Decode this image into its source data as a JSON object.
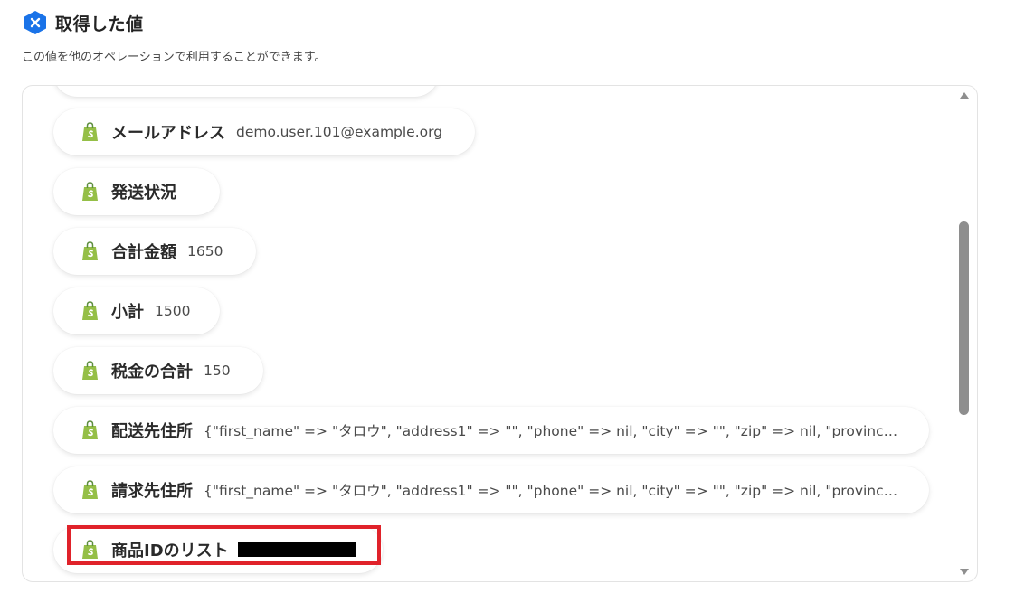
{
  "header": {
    "title": "取得した値",
    "subtitle": "この値を他のオペレーションで利用することができます。",
    "brand_color": "#1a73e8"
  },
  "items": [
    {
      "label": "メールアドレス",
      "value": "demo.user.101@example.org"
    },
    {
      "label": "発送状況",
      "value": ""
    },
    {
      "label": "合計金額",
      "value": "1650"
    },
    {
      "label": "小計",
      "value": "1500"
    },
    {
      "label": "税金の合計",
      "value": "150"
    },
    {
      "label": "配送先住所",
      "value": "{\"first_name\" => \"タロウ\", \"address1\" => \"\", \"phone\" => nil, \"city\" => \"\", \"zip\" => nil, \"province\" => nil, \"country\" => nil}"
    },
    {
      "label": "請求先住所",
      "value": "{\"first_name\" => \"タロウ\", \"address1\" => \"\", \"phone\" => nil, \"city\" => \"\", \"zip\" => nil, \"province\" => nil, \"country\" => nil}"
    },
    {
      "label": "商品IDのリスト",
      "value": "",
      "redacted": true
    }
  ],
  "icons": {
    "item_icon": "shopify-bag-icon",
    "header_icon": "yoom-x-icon"
  },
  "colors": {
    "shopify_green": "#95bf47",
    "highlight_red": "#e0222a",
    "scroll_thumb": "#8e8e8e"
  }
}
